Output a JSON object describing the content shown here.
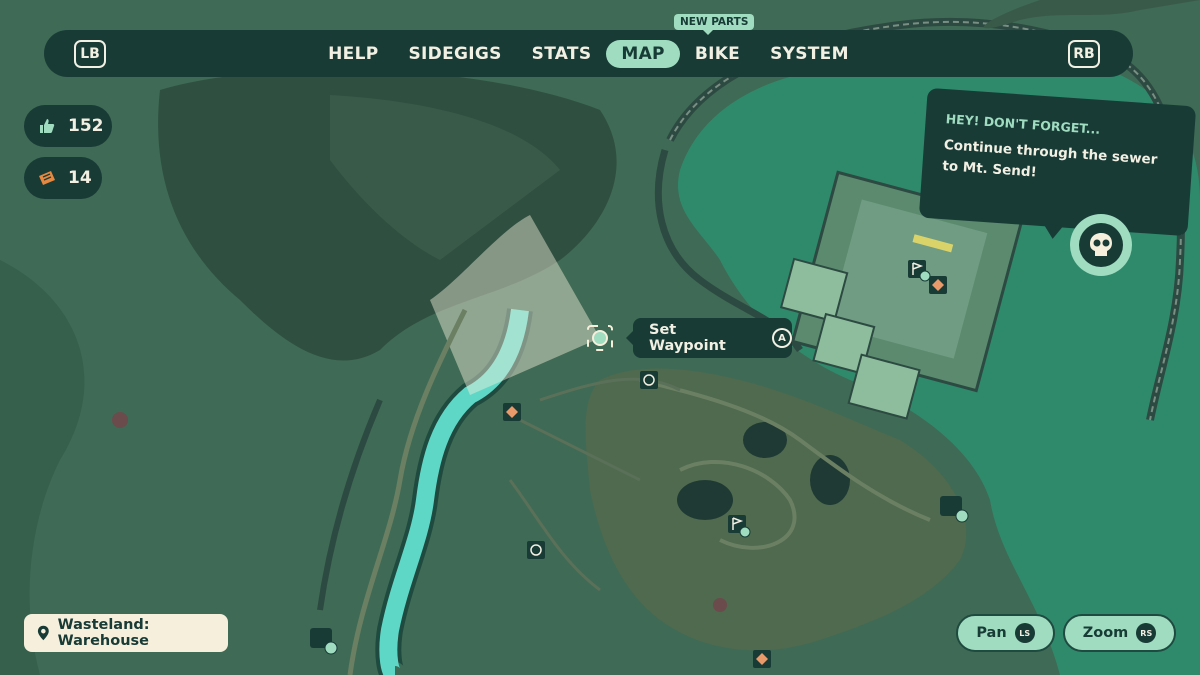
{
  "nav": {
    "left_shoulder": "LB",
    "right_shoulder": "RB",
    "tabs": [
      "HELP",
      "SIDEGIGS",
      "STATS",
      "MAP",
      "BIKE",
      "SYSTEM"
    ],
    "active_tab": "MAP",
    "badge": "NEW PARTS"
  },
  "counters": {
    "likes": "152",
    "tickets": "14"
  },
  "waypoint": {
    "label": "Set Waypoint",
    "button": "A"
  },
  "reminder": {
    "heading": "HEY! DON'T FORGET...",
    "body": "Continue through the sewer to Mt. Send!"
  },
  "location": {
    "label": "Wasteland: Warehouse"
  },
  "controls": {
    "pan": "Pan",
    "pan_stick": "LS",
    "zoom": "Zoom",
    "zoom_stick": "RS"
  },
  "colors": {
    "panel": "#183b36",
    "accent": "#9fdcc0",
    "map_ground": "#3f6a55",
    "river": "#5fd7c6",
    "cream": "#f5efdc"
  }
}
